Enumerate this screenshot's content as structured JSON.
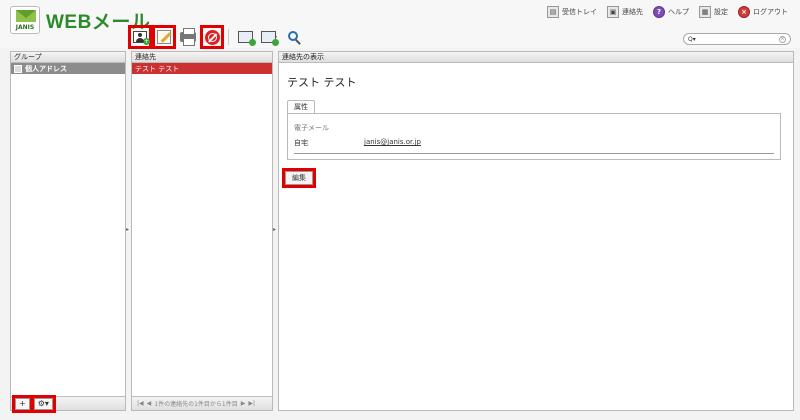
{
  "app": {
    "brand_badge": "JANIS",
    "title": "WEBメール"
  },
  "topnav": {
    "inbox": "受信トレイ",
    "contacts": "連絡先",
    "help": "ヘルプ",
    "settings": "設定",
    "logout": "ログアウト"
  },
  "toolbar": {
    "icons": [
      "add-contact-icon",
      "edit-contact-icon",
      "print-icon",
      "delete-icon",
      "import-icon",
      "export-icon",
      "search-icon"
    ]
  },
  "search": {
    "prefix": "Q▾",
    "value": "",
    "clear": "×"
  },
  "groups": {
    "header": "グループ",
    "items": [
      {
        "label": "個人アドレス",
        "selected": true
      }
    ],
    "add_label": "+",
    "menu_label": "⚙▾"
  },
  "contacts": {
    "header": "連絡先",
    "items": [
      {
        "label": "テスト テスト",
        "selected": true
      }
    ],
    "pager_first": "|◀",
    "pager_prev": "◀",
    "pager_text": "1件の連絡先の1件目から1件目",
    "pager_next": "▶",
    "pager_last": "▶|"
  },
  "detail": {
    "header": "連絡先の表示",
    "name": "テスト テスト",
    "tab": "属性",
    "field_label": "電子メール",
    "field_type": "自宅",
    "field_value": "janis@janis.or.jp",
    "edit_button": "編集"
  },
  "colors": {
    "accent_red": "#e00000",
    "selected_row": "#cc3131",
    "brand_green": "#2c8a2c"
  }
}
